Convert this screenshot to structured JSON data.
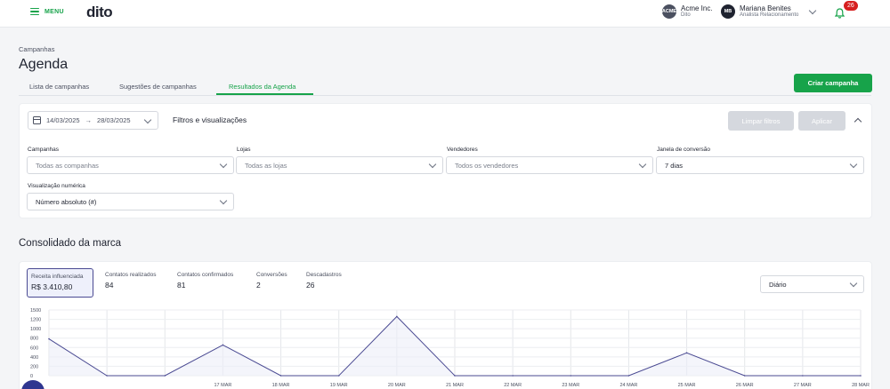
{
  "topbar": {
    "menu_label": "MENU",
    "logo": "dito",
    "company": {
      "avatar": "ACME",
      "name": "Acme Inc.",
      "sub": "Dito"
    },
    "user": {
      "avatar": "MB",
      "name": "Mariana Benites",
      "role": "Analista Relacionamento"
    },
    "notifications": "26"
  },
  "header": {
    "breadcrumb": "Campanhas",
    "title": "Agenda",
    "tabs": [
      "Lista de campanhas",
      "Sugestões de campanhas",
      "Resultados da Agenda"
    ],
    "active_tab": 2,
    "create_button": "Criar campanha"
  },
  "filters": {
    "date_from": "14/03/2025",
    "date_arrow": "→",
    "date_to": "28/03/2025",
    "title": "Filtros e visualizações",
    "clear_button": "Limpar filtros",
    "apply_button": "Aplicar",
    "fields": [
      {
        "label": "Campanhas",
        "value": "Todas as companhas"
      },
      {
        "label": "Lojas",
        "value": "Todas as lojas"
      },
      {
        "label": "Vendedores",
        "value": "Todos os vendedores"
      },
      {
        "label": "Janela de conversão",
        "value": "7 dias"
      }
    ],
    "numeric_view": {
      "label": "Visualização numérica",
      "value": "Número absoluto (#)"
    }
  },
  "consolidated": {
    "title": "Consolidado da marca",
    "metrics": [
      {
        "label": "Receita influenciada",
        "value": "R$ 3.410,80"
      },
      {
        "label": "Contatos realizados",
        "value": "84"
      },
      {
        "label": "Contatos confirmados",
        "value": "81"
      },
      {
        "label": "Conversões",
        "value": "2"
      },
      {
        "label": "Descadastros",
        "value": "26"
      }
    ],
    "granularity": "Diário"
  },
  "colors": {
    "accent": "#17a34a",
    "series": "#4a4a92",
    "badge": "#d61f1f"
  },
  "chart_data": {
    "type": "line",
    "y_ticks": [
      "1500",
      "1200",
      "1000",
      "800",
      "600",
      "400",
      "200",
      "0"
    ],
    "ylim": [
      0,
      1500
    ],
    "x_labels": [
      "",
      "",
      "",
      "17 MAR",
      "18 MAR",
      "19 MAR",
      "20 MAR",
      "21 MAR",
      "22 MAR",
      "23 MAR",
      "24 MAR",
      "25 MAR",
      "26 MAR",
      "27 MAR",
      "28 MAR"
    ],
    "series": [
      {
        "values": [
          840,
          0,
          0,
          700,
          0,
          0,
          1350,
          0,
          0,
          0,
          0,
          520,
          0,
          0,
          0
        ]
      }
    ],
    "grid": true
  }
}
